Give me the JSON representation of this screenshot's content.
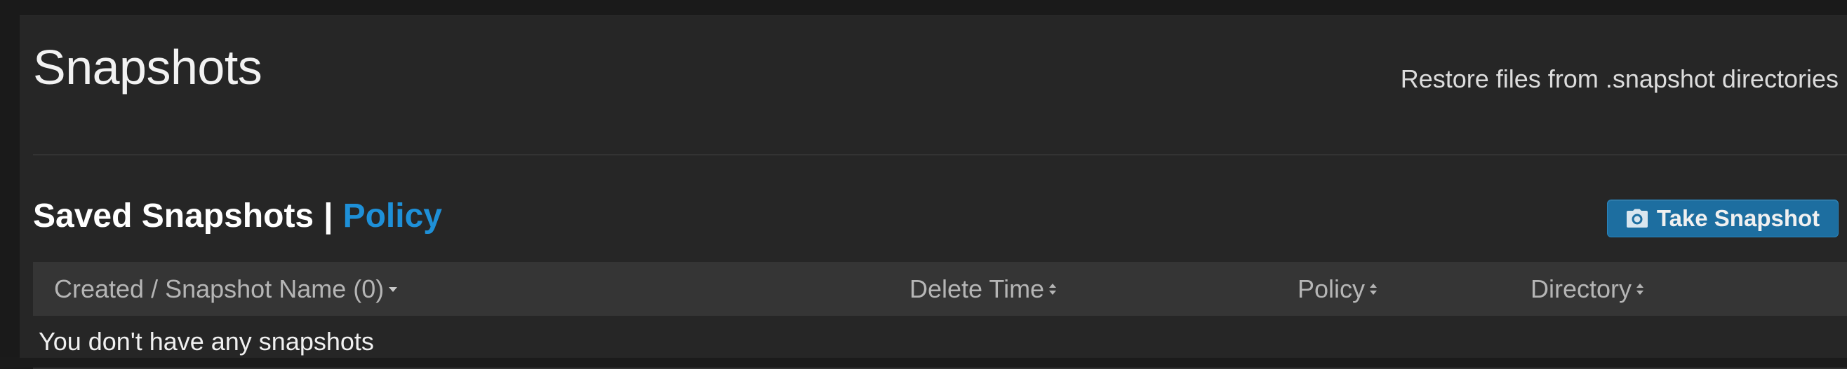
{
  "header": {
    "title": "Snapshots",
    "subtitle": "Restore files from .snapshot directories"
  },
  "section": {
    "saved_label": "Saved Snapshots",
    "separator": "|",
    "policy_link": "Policy",
    "take_snapshot_button": "Take Snapshot"
  },
  "table": {
    "columns": [
      {
        "label": "Created / Snapshot Name (0)",
        "sort": "desc"
      },
      {
        "label": "Delete Time",
        "sort": "both"
      },
      {
        "label": "Policy",
        "sort": "both"
      },
      {
        "label": "Directory",
        "sort": "both"
      }
    ],
    "empty_message": "You don't have any snapshots"
  },
  "colors": {
    "accent": "#1e90d8",
    "button": "#1d6ea0",
    "panel": "#262626",
    "header_row": "#353535"
  },
  "icons": {
    "button_icon": "camera-icon",
    "sort_desc": "caret-down-icon",
    "sort_both": "sort-icon"
  }
}
